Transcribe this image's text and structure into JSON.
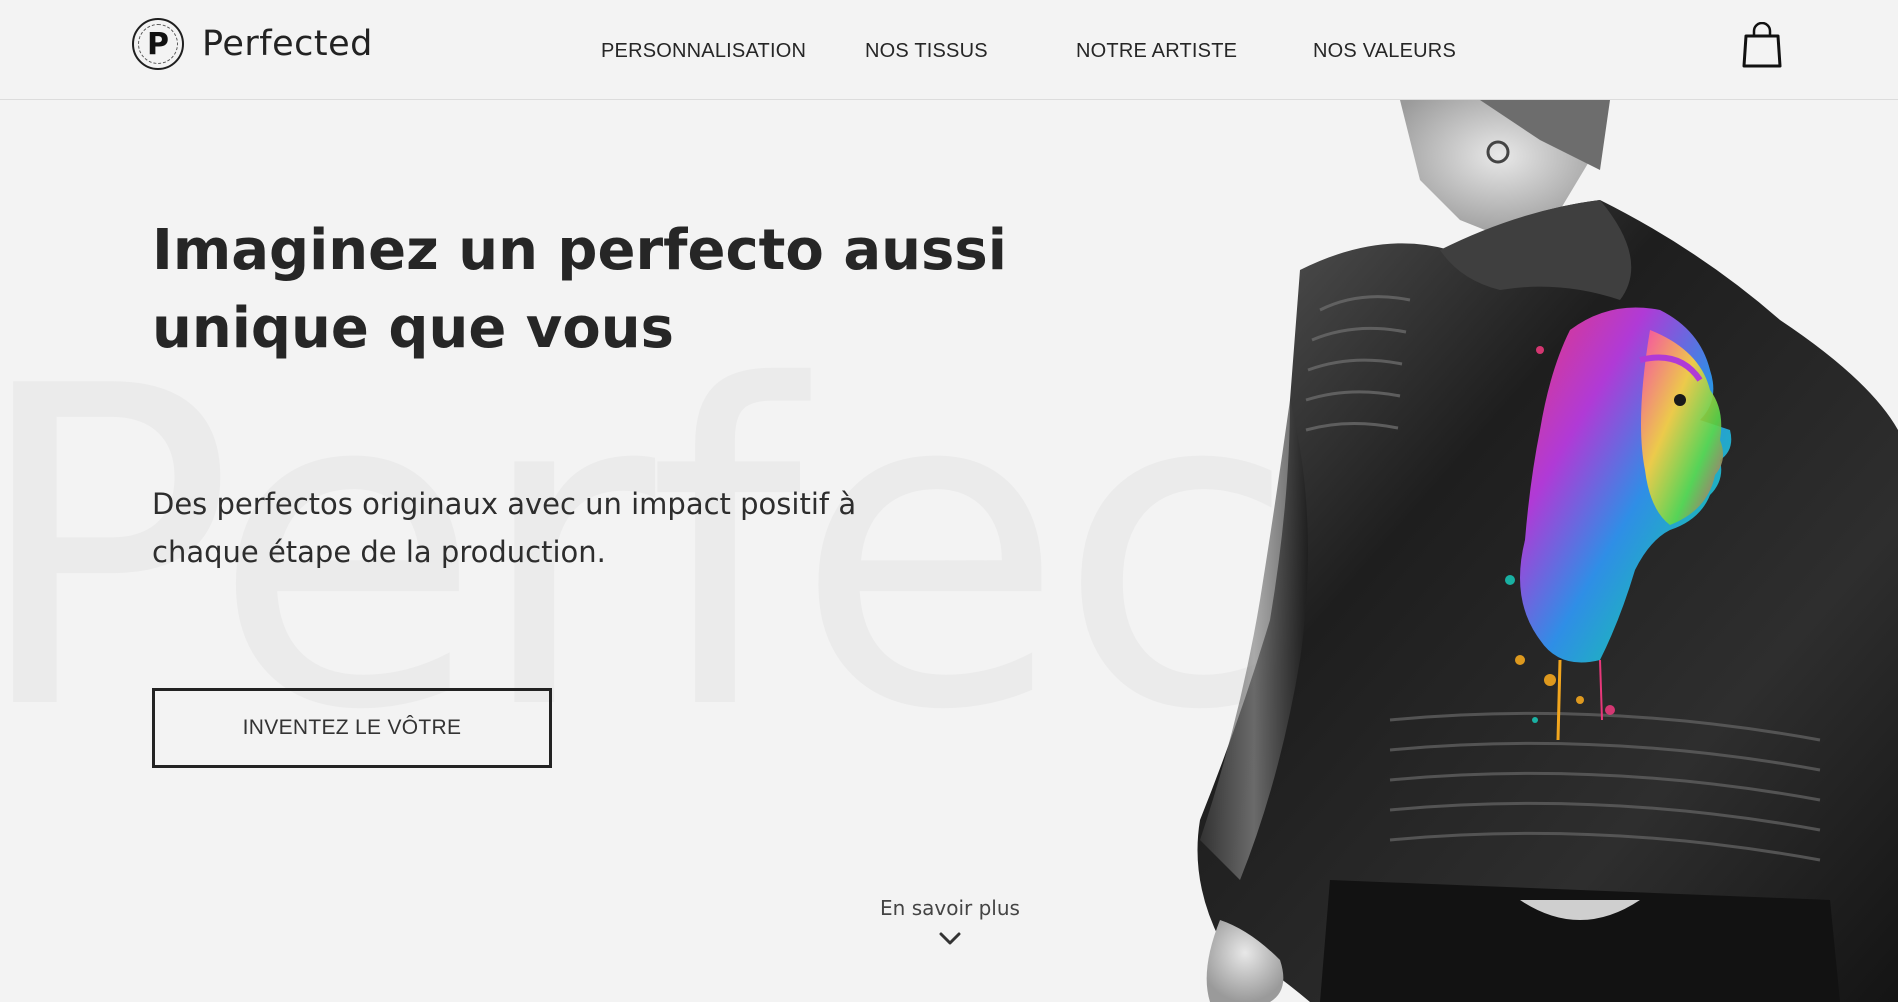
{
  "header": {
    "brand_letter": "P",
    "brand_name": "Perfected",
    "nav": [
      {
        "label": "PERSONNALISATION"
      },
      {
        "label": "NOS TISSUS"
      },
      {
        "label": "NOTRE ARTISTE"
      },
      {
        "label": "NOS VALEURS"
      }
    ],
    "cart_icon": "shopping-bag-icon"
  },
  "hero": {
    "watermark": "Perfec",
    "title": "Imaginez un perfecto aussi unique que vous",
    "subtitle": "Des perfectos originaux avec un impact positif à chaque étape de la production.",
    "cta_label": "INVENTEZ LE VÔTRE",
    "more_label": "En savoir plus",
    "more_icon": "chevron-down-icon"
  },
  "colors": {
    "background": "#f3f3f3",
    "text": "#262626",
    "watermark": "#ebebeb"
  }
}
